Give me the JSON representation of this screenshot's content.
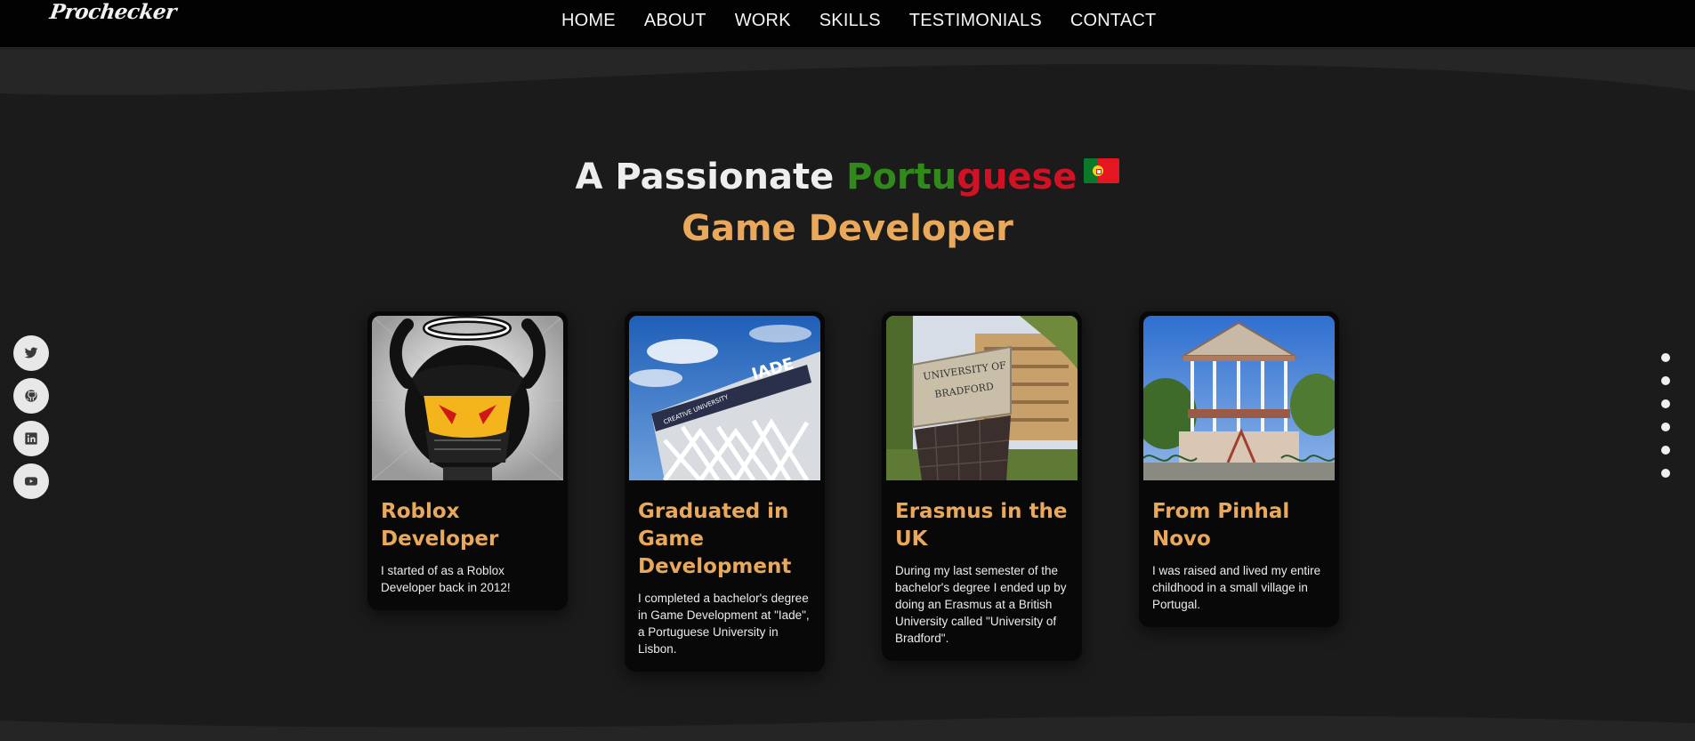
{
  "nav": {
    "logo": "Prochecker",
    "links": [
      "HOME",
      "ABOUT",
      "WORK",
      "SKILLS",
      "TESTIMONIALS",
      "CONTACT"
    ]
  },
  "hero": {
    "prefix": "A Passionate ",
    "word_green": "Portu",
    "word_red": "guese",
    "line2": "Game Developer"
  },
  "social": [
    "twitter-icon",
    "github-icon",
    "linkedin-icon",
    "youtube-icon"
  ],
  "section_dots": 6,
  "cards": [
    {
      "title": "Roblox Developer",
      "text": "I started of as a Roblox Developer back in 2012!"
    },
    {
      "title": "Graduated in Game Development",
      "text": "I completed a bachelor's degree in Game Development at \"Iade\", a Portuguese University in Lisbon."
    },
    {
      "title": "Erasmus in the UK",
      "text": "During my last semester of the bachelor's degree I ended up by doing an Erasmus at a British University called \"University of Bradford\"."
    },
    {
      "title": "From Pinhal Novo",
      "text": "I was raised and lived my entire childhood in a small village in Portugal."
    }
  ],
  "images": {
    "iade_sign": "IADE",
    "iade_sub": "CREATIVE UNIVERSITY",
    "bradford_sign_line1": "UNIVERSITY OF",
    "bradford_sign_line2": "BRADFORD"
  },
  "colors": {
    "accent": "#e9a85a",
    "green": "#2f8a1a",
    "red": "#d11224",
    "background": "#1b1b1b",
    "nav_bg": "#020202"
  }
}
